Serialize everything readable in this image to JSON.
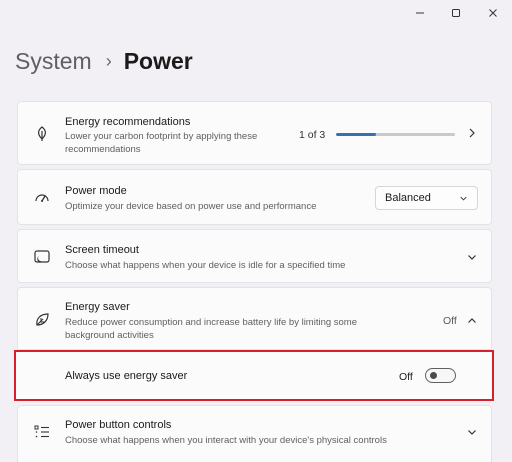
{
  "window": {
    "controls": [
      "minimize",
      "maximize",
      "close"
    ]
  },
  "breadcrumb": {
    "parent": "System",
    "separator": "›",
    "current": "Power"
  },
  "energy_recommendations": {
    "title": "Energy recommendations",
    "description": "Lower your carbon footprint by applying these recommendations",
    "progress_text": "1 of 3",
    "progress_fraction": 0.333,
    "icon": "leaf-icon"
  },
  "power_mode": {
    "title": "Power mode",
    "description": "Optimize your device based on power use and performance",
    "selected": "Balanced",
    "icon": "speedometer-icon"
  },
  "screen_timeout": {
    "title": "Screen timeout",
    "description": "Choose what happens when your device is idle for a specified time",
    "icon": "screen-timeout-icon"
  },
  "energy_saver": {
    "title": "Energy saver",
    "description": "Reduce power consumption and increase battery life by limiting some background activities",
    "status": "Off",
    "icon": "energy-saver-leaf-icon",
    "always_use": {
      "label": "Always use energy saver",
      "toggle_label": "Off",
      "toggle_on": false
    }
  },
  "power_button_controls": {
    "title": "Power button controls",
    "description": "Choose what happens when you interact with your device's physical controls",
    "icon": "list-icon"
  },
  "colors": {
    "accent": "#3670b0",
    "highlight_border": "#d4202a",
    "background": "#f3f0f5"
  }
}
